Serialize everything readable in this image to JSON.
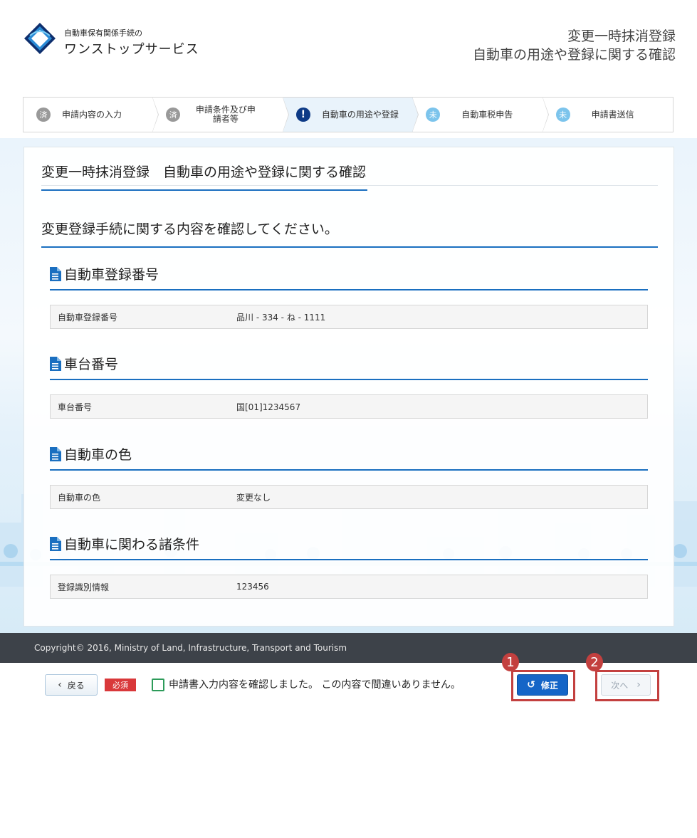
{
  "header": {
    "brand_small": "自動車保有関係手続の",
    "brand_large": "ワンストップサービス",
    "title_line1": "変更一時抹消登録",
    "title_line2": "自動車の用途や登録に関する確認"
  },
  "steps": [
    {
      "status_icon": "済",
      "label": "申請内容の入力",
      "state": "done"
    },
    {
      "status_icon": "済",
      "label": "申請条件及び申請者等",
      "state": "done"
    },
    {
      "status_icon": "!",
      "label": "自動車の用途や登録",
      "state": "current"
    },
    {
      "status_icon": "未",
      "label": "自動車税申告",
      "state": "todo"
    },
    {
      "status_icon": "未",
      "label": "申請書送信",
      "state": "todo"
    }
  ],
  "card": {
    "title": "変更一時抹消登録　自動車の用途や登録に関する確認",
    "instruction": "変更登録手続に関する内容を確認してください。"
  },
  "sections": [
    {
      "heading": "自動車登録番号",
      "label": "自動車登録番号",
      "value": "品川 - 334 - ね - 1111"
    },
    {
      "heading": "車台番号",
      "label": "車台番号",
      "value": "国[01]1234567"
    },
    {
      "heading": "自動車の色",
      "label": "自動車の色",
      "value": "変更なし"
    },
    {
      "heading": "自動車に関わる諸条件",
      "label": "登録識別情報",
      "value": "123456"
    }
  ],
  "footer": {
    "copyright": "Copyright© 2016, Ministry of Land, Infrastructure, Transport and Tourism"
  },
  "actions": {
    "back_label": "戻る",
    "back_icon": "‹",
    "required_label": "必須",
    "confirm_text": "申請書入力内容を確認しました。 この内容で間違いありません。",
    "edit_label": "修正",
    "edit_icon": "↺",
    "next_label": "次へ",
    "next_icon": "›",
    "badge1": "1",
    "badge2": "2"
  },
  "colors": {
    "accent": "#1a6fc0",
    "primary_button": "#1565c7",
    "highlight": "#c3403f",
    "footer_bg": "#3d4249"
  }
}
